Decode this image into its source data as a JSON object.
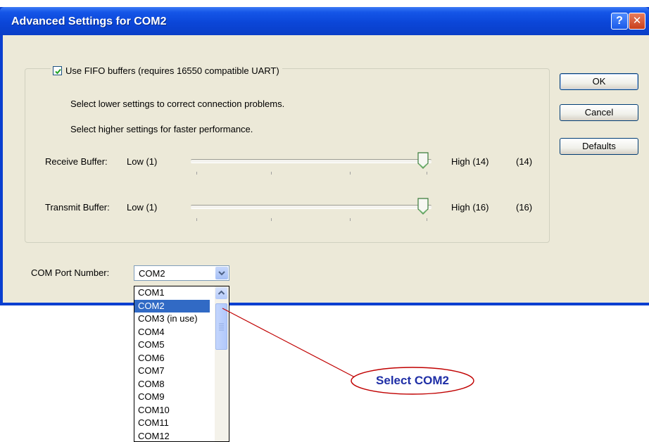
{
  "window": {
    "title": "Advanced Settings for COM2",
    "help_label": "?",
    "close_label": "✕"
  },
  "fifo": {
    "checked": true,
    "label": "Use FIFO buffers (requires 16550 compatible UART)",
    "hint_lower": "Select lower settings to correct connection problems.",
    "hint_higher": "Select higher settings for faster performance."
  },
  "receive": {
    "label": "Receive Buffer:",
    "low_label": "Low (1)",
    "high_label": "High (14)",
    "value_label": "(14)",
    "min": 1,
    "max": 14,
    "value": 14
  },
  "transmit": {
    "label": "Transmit Buffer:",
    "low_label": "Low (1)",
    "high_label": "High (16)",
    "value_label": "(16)",
    "min": 1,
    "max": 16,
    "value": 16
  },
  "buttons": {
    "ok": "OK",
    "cancel": "Cancel",
    "defaults": "Defaults"
  },
  "com_port": {
    "label": "COM Port Number:",
    "selected": "COM2",
    "options": [
      "COM1",
      "COM2",
      "COM3 (in use)",
      "COM4",
      "COM5",
      "COM6",
      "COM7",
      "COM8",
      "COM9",
      "COM10",
      "COM11",
      "COM12"
    ],
    "highlighted_index": 1
  },
  "annotation": {
    "text": "Select COM2",
    "color": "#1e2ea6",
    "line_color": "#c00000"
  }
}
